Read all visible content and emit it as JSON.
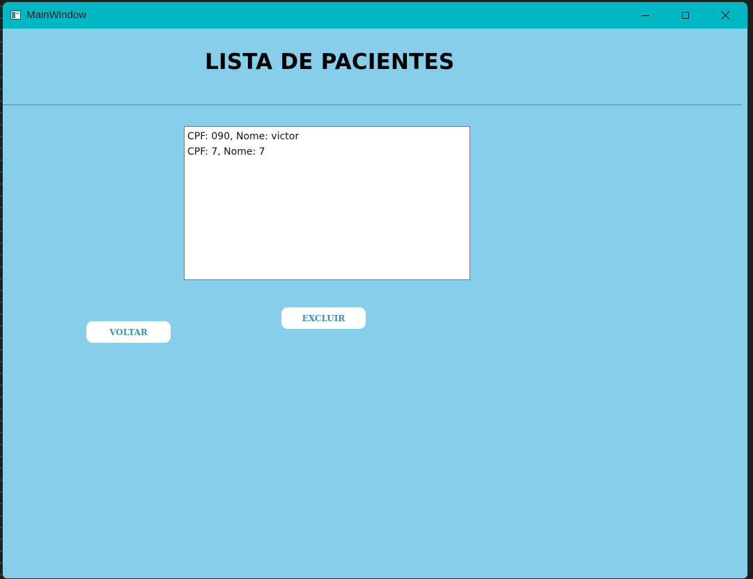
{
  "window": {
    "title": "MainWindow"
  },
  "page": {
    "title": "LISTA DE PACIENTES"
  },
  "patients": [
    "CPF: 090, Nome: victor",
    "CPF: 7, Nome: 7"
  ],
  "buttons": {
    "delete_label": "EXCLUIR",
    "back_label": "VOLTAR"
  },
  "colors": {
    "titlebar": "#00b7c3",
    "background": "#87ceeb",
    "button_text": "#3f8fb5"
  }
}
